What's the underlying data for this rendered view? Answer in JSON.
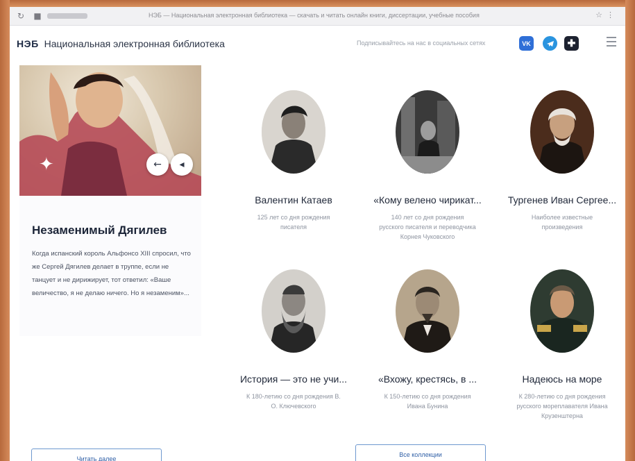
{
  "browser": {
    "tab_title": "НЭБ — Национальная электронная библиотека — скачать и читать онлайн книги, диссертации, учебные пособия"
  },
  "header": {
    "logo": "НЭБ",
    "site_name": "Национальная электронная библиотека",
    "subscribe_text": "Подписывайтесь на нас в социальных сетях",
    "social": [
      "vk",
      "telegram",
      "ok"
    ]
  },
  "feature": {
    "title": "Незаменимый Дягилев",
    "text": "Когда испанский король Альфонсо XIII спросил, что же Сергей Дягилев делает в труппе, если не танцует и не дирижирует, тот ответил: «Ваше величество, я не делаю ничего. Но я незаменим»..."
  },
  "cards": [
    {
      "title": "Валентин Катаев",
      "subtitle": "125 лет со дня рождения писателя"
    },
    {
      "title": "«Кому велено чирикат...",
      "subtitle": "140 лет со дня рождения русского писателя и переводчика Корнея Чуковского"
    },
    {
      "title": "Тургенев Иван Сергее...",
      "subtitle": "Наиболее известные произведения"
    },
    {
      "title": "История — это не учи...",
      "subtitle": "К 180-летию со дня рождения В. О. Ключевского"
    },
    {
      "title": "«Вхожу, крестясь, в ...",
      "subtitle": "К 150-летию со дня рождения Ивана Бунина"
    },
    {
      "title": "Надеюсь на море",
      "subtitle": "К 280-летию со дня рождения русского морепла­вателя Ивана Крузенштерна"
    }
  ],
  "buttons": {
    "left": "Читать далее",
    "center": "Все коллекции"
  },
  "colors": {
    "accent": "#2f6fd7",
    "frame": "#c9774a"
  }
}
